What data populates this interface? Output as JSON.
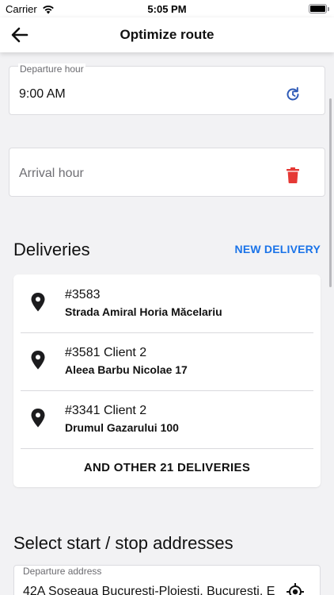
{
  "status_bar": {
    "carrier": "Carrier",
    "time": "5:05 PM",
    "battery_level": 1.0
  },
  "nav": {
    "title": "Optimize route",
    "back_icon": "arrow-left-icon"
  },
  "departure": {
    "label": "Departure hour",
    "value": "9:00 AM",
    "icon": "reset-time-icon",
    "icon_color": "#2f5bb7"
  },
  "arrival": {
    "placeholder": "Arrival hour",
    "icon": "trash-icon",
    "icon_color": "#e53935"
  },
  "deliveries": {
    "title": "Deliveries",
    "new_label": "NEW DELIVERY",
    "items": [
      {
        "id": "#3583",
        "address": "Strada Amiral Horia Măcelariu"
      },
      {
        "id": "#3581 Client 2",
        "address": "Aleea Barbu Nicolae 17"
      },
      {
        "id": "#3341 Client 2",
        "address": "Drumul Gazarului 100"
      }
    ],
    "more_label": "AND OTHER 21 DELIVERIES"
  },
  "addresses": {
    "title": "Select start / stop addresses",
    "departure_label": "Departure address",
    "departure_value": "42A Soseaua Bucuresti-Ploiesti, Bucuresti, E",
    "icon": "locate-icon"
  },
  "colors": {
    "accent": "#1a73e8",
    "background": "#f2f2f4"
  }
}
